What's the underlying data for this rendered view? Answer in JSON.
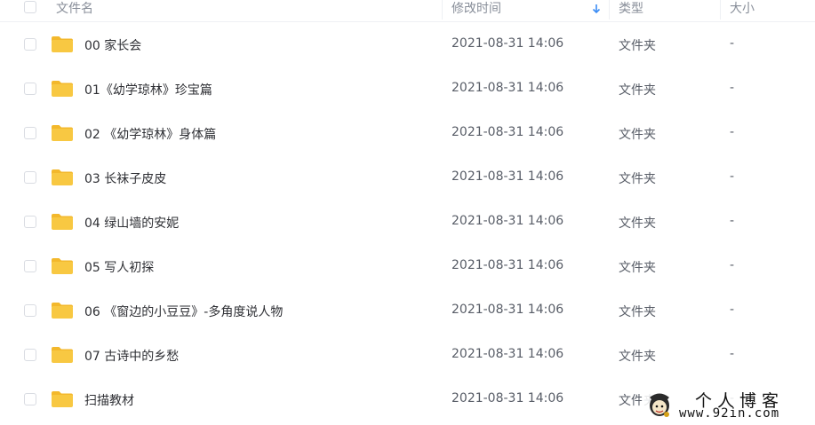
{
  "columns": {
    "name": "文件名",
    "modified": "修改时间",
    "type": "类型",
    "size": "大小"
  },
  "sort": {
    "column": "modified",
    "direction": "down",
    "icon": "arrow-down-icon"
  },
  "files": [
    {
      "name": "00 家长会",
      "modified": "2021-08-31 14:06",
      "type": "文件夹",
      "size": "-"
    },
    {
      "name": "01《幼学琼林》珍宝篇",
      "modified": "2021-08-31 14:06",
      "type": "文件夹",
      "size": "-"
    },
    {
      "name": "02 《幼学琼林》身体篇",
      "modified": "2021-08-31 14:06",
      "type": "文件夹",
      "size": "-"
    },
    {
      "name": "03 长袜子皮皮",
      "modified": "2021-08-31 14:06",
      "type": "文件夹",
      "size": "-"
    },
    {
      "name": "04 绿山墙的安妮",
      "modified": "2021-08-31 14:06",
      "type": "文件夹",
      "size": "-"
    },
    {
      "name": "05 写人初探",
      "modified": "2021-08-31 14:06",
      "type": "文件夹",
      "size": "-"
    },
    {
      "name": "06 《窗边的小豆豆》-多角度说人物",
      "modified": "2021-08-31 14:06",
      "type": "文件夹",
      "size": "-"
    },
    {
      "name": "07 古诗中的乡愁",
      "modified": "2021-08-31 14:06",
      "type": "文件夹",
      "size": "-"
    },
    {
      "name": "扫描教材",
      "modified": "2021-08-31 14:06",
      "type": "文件夹",
      "size": "-"
    }
  ],
  "watermark": {
    "title": "个人博客",
    "url": "www.92in.com"
  },
  "colors": {
    "folder": "#f8c842",
    "folder_tab": "#f3b82c",
    "sort_arrow": "#3b8cf5",
    "border": "#eef0f4"
  }
}
